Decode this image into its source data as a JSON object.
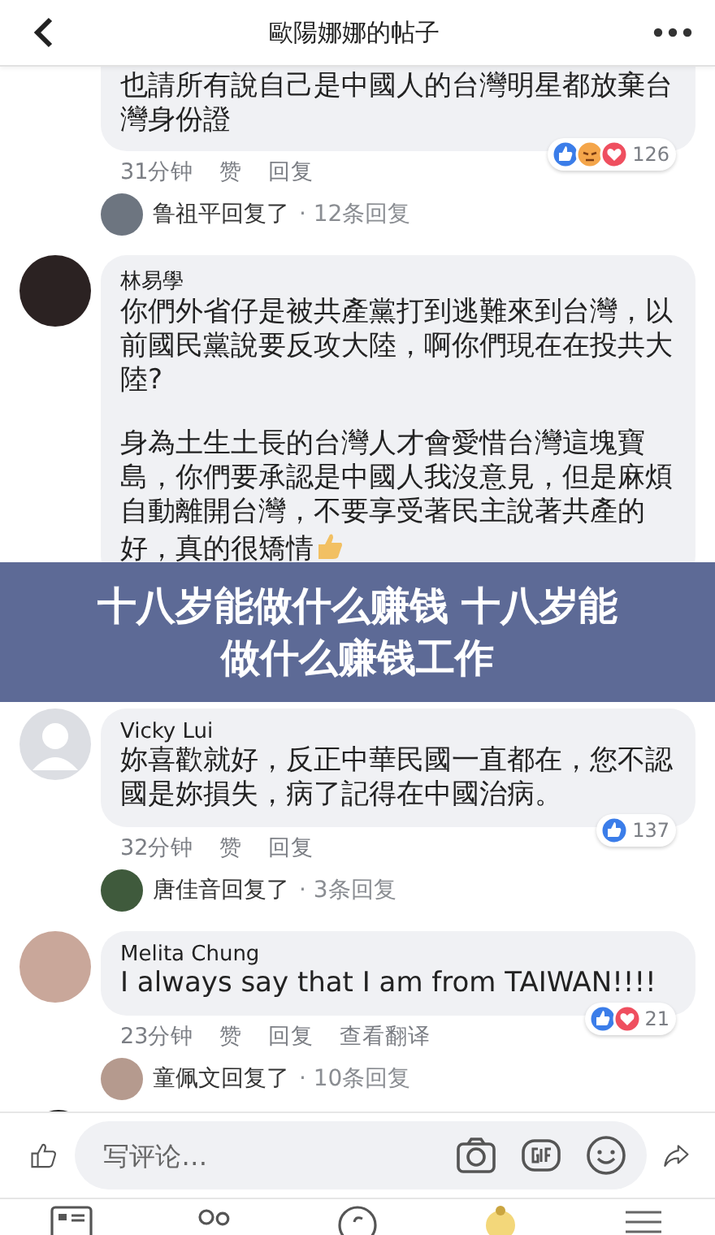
{
  "header": {
    "title": "歐陽娜娜的帖子"
  },
  "comments": [
    {
      "paragraphs": [
        "也請所有說自己是中國人的台灣明星都放棄台灣身份證"
      ],
      "time": "31分钟",
      "actions": [
        "赞",
        "回复"
      ],
      "reactions": [
        {
          "kind": "like"
        },
        {
          "kind": "angry"
        },
        {
          "kind": "love"
        }
      ],
      "reaction_count": "126",
      "reply": {
        "replier": "鲁祖平回复了",
        "summary": "· 12条回复"
      },
      "cut_top": true
    },
    {
      "author": "林易學",
      "paragraphs": [
        "你們外省仔是被共產黨打到逃難來到台灣，以前國民黨說要反攻大陸，啊你們現在在投共大陸?",
        "身為土生土長的台灣人才會愛惜台灣這塊寶島，你們要承認是中國人我沒意見，但是麻煩自動離開台灣，不要享受著民主說著共產的好，真的很矯情"
      ],
      "thumb_emoji": true,
      "cut_top": false
    },
    {
      "author": "Vicky Lui",
      "paragraphs": [
        "妳喜歡就好，反正中華民國一直都在，您不認國是妳損失，病了記得在中國治病。"
      ],
      "time": "32分钟",
      "actions": [
        "赞",
        "回复"
      ],
      "reactions": [
        {
          "kind": "like"
        }
      ],
      "reaction_count": "137",
      "reply": {
        "replier": "唐佳音回复了",
        "summary": "· 3条回复"
      },
      "cut_top": false,
      "default_avatar": true
    },
    {
      "author": "Melita Chung",
      "paragraphs": [
        "I always say that I am from TAIWAN!!!!"
      ],
      "time": "23分钟",
      "actions": [
        "赞",
        "回复",
        "查看翻译"
      ],
      "reactions": [
        {
          "kind": "like"
        },
        {
          "kind": "love"
        }
      ],
      "reaction_count": "21",
      "reply": {
        "replier": "童佩文回复了",
        "summary": "· 10条回复"
      },
      "cut_top": false
    }
  ],
  "banner": {
    "text": "十八岁能做什么赚钱 十八岁能做什么赚钱工作"
  },
  "composer": {
    "placeholder": "写评论…"
  }
}
